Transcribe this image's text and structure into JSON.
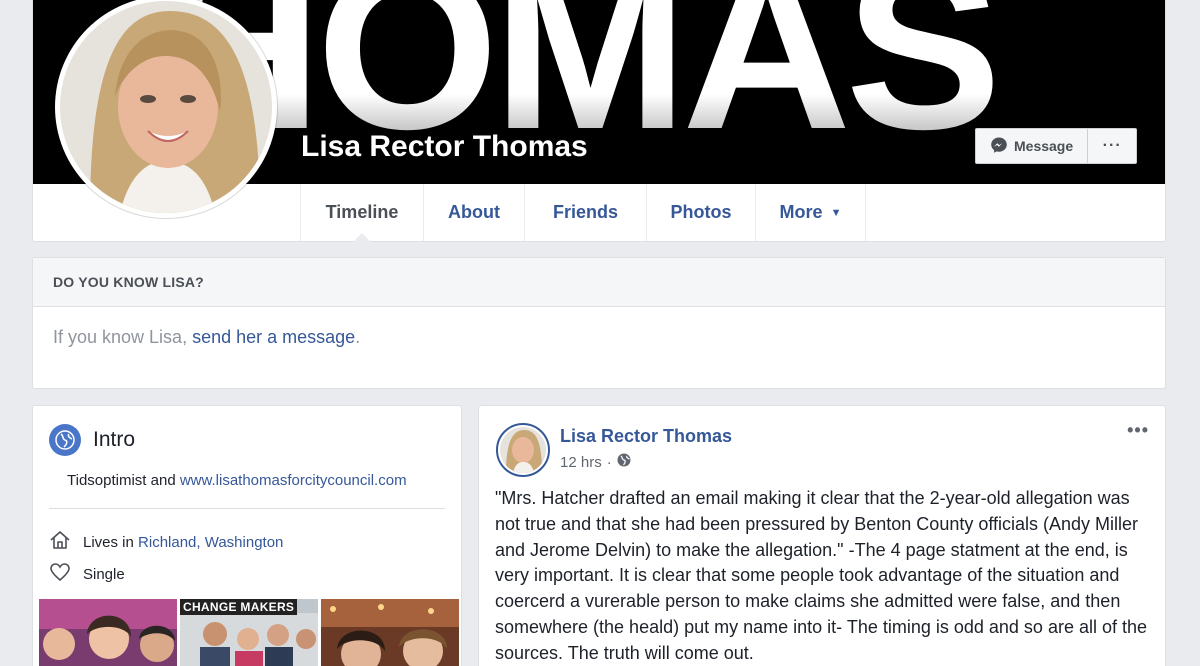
{
  "cover": {
    "text": "HOMAS",
    "profile_name": "Lisa Rector Thomas",
    "message_button": "Message",
    "more_button": "···"
  },
  "nav": {
    "tabs": [
      {
        "label": "Timeline",
        "active": true
      },
      {
        "label": "About"
      },
      {
        "label": "Friends"
      },
      {
        "label": "Photos"
      },
      {
        "label": "More",
        "has_dropdown": true
      }
    ],
    "more_caret": "▼"
  },
  "know": {
    "header": "DO YOU KNOW LISA?",
    "prefix": "If you know Lisa,",
    "link": "send her a message",
    "suffix": "."
  },
  "intro": {
    "title": "Intro",
    "bio_text": "Tidsoptimist and",
    "bio_link": "www.lisathomasforcitycouncil.com",
    "lives_prefix": "Lives in",
    "lives_place": "Richland, Washington",
    "relationship": "Single",
    "photo_label": "CHANGE MAKERS"
  },
  "post": {
    "author": "Lisa Rector Thomas",
    "time": "12 hrs",
    "separator": "·",
    "menu": "•••",
    "text": "\"Mrs. Hatcher drafted an email making it clear that the 2-year-old allegation was not true and that she had been pressured by Benton County officials (Andy Miller and Jerome Delvin) to make the allegation.\" -The 4 page statment at the end, is very important. It is clear that some people took advantage of the situation and coercerd a vurerable person to make claims she admitted were false, and then somewhere (the heald) put my name into it- The timing is odd and so are all of the sources. The truth will come out."
  },
  "colors": {
    "link": "#365899",
    "page_bg": "#e9ebee",
    "globe": "#4a76c9"
  },
  "icons": [
    "messenger-icon",
    "globe-icon",
    "home-icon",
    "heart-icon",
    "public-globe-icon"
  ]
}
